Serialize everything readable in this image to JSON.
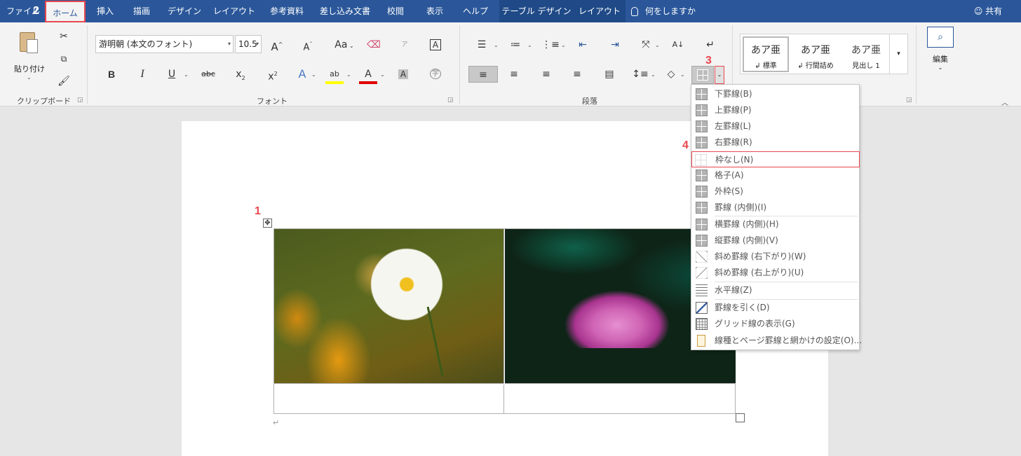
{
  "tabs": [
    {
      "label": "ファイル"
    },
    {
      "label": "ホーム"
    },
    {
      "label": "挿入"
    },
    {
      "label": "描画"
    },
    {
      "label": "デザイン"
    },
    {
      "label": "レイアウト"
    },
    {
      "label": "参考資料"
    },
    {
      "label": "差し込み文書"
    },
    {
      "label": "校閲"
    },
    {
      "label": "表示"
    },
    {
      "label": "ヘルプ"
    },
    {
      "label": "テーブル デザイン"
    },
    {
      "label": "レイアウト"
    }
  ],
  "tellme": "何をしますか",
  "share": "共有",
  "clipboard": {
    "paste": "貼り付け",
    "label": "クリップボード"
  },
  "font": {
    "name": "游明朝 (本文のフォント)",
    "size": "10.5",
    "label": "フォント",
    "bold": "B",
    "italic": "I",
    "underline": "U",
    "strike": "abc",
    "sub": "x",
    "sup": "x",
    "subnum": "2",
    "grow": "A",
    "shrink": "A",
    "case": "Aa",
    "highlight": "ab",
    "color": "A",
    "charshade": "A",
    "effects": "A",
    "box": "A",
    "enclose": "字"
  },
  "paragraph": {
    "label": "段落"
  },
  "styles": [
    {
      "sample": "あア亜",
      "name": "↲ 標準"
    },
    {
      "sample": "あア亜",
      "name": "↲ 行間詰め"
    },
    {
      "sample": "あア亜",
      "name": "見出し 1"
    }
  ],
  "editing": {
    "label": "編集"
  },
  "borders_menu": [
    {
      "label": "下罫線(B)",
      "style": "solid"
    },
    {
      "label": "上罫線(P)",
      "style": "solid"
    },
    {
      "label": "左罫線(L)",
      "style": "solid"
    },
    {
      "label": "右罫線(R)",
      "style": "solid"
    },
    {
      "label": "枠なし(N)",
      "style": "none"
    },
    {
      "label": "格子(A)",
      "style": "solid"
    },
    {
      "label": "外枠(S)",
      "style": "solid"
    },
    {
      "label": "罫線 (内側)(I)",
      "style": "solid"
    },
    {
      "label": "横罫線 (内側)(H)",
      "style": "solid"
    },
    {
      "label": "縦罫線 (内側)(V)",
      "style": "solid"
    },
    {
      "label": "斜め罫線 (右下がり)(W)",
      "style": "diag-down"
    },
    {
      "label": "斜め罫線 (右上がり)(U)",
      "style": "diag-up"
    },
    {
      "label": "水平線(Z)",
      "style": "hline"
    },
    {
      "label": "罫線を引く(D)",
      "style": "draw"
    },
    {
      "label": "グリッド線の表示(G)",
      "style": "grid"
    },
    {
      "label": "線種とページ罫線と網かけの設定(O)...",
      "style": "page"
    }
  ],
  "steps": [
    "1",
    "2",
    "3",
    "4"
  ],
  "paragraph_mark": "↵",
  "colors": {
    "brand": "#2b579a",
    "accent": "#e8474f"
  }
}
